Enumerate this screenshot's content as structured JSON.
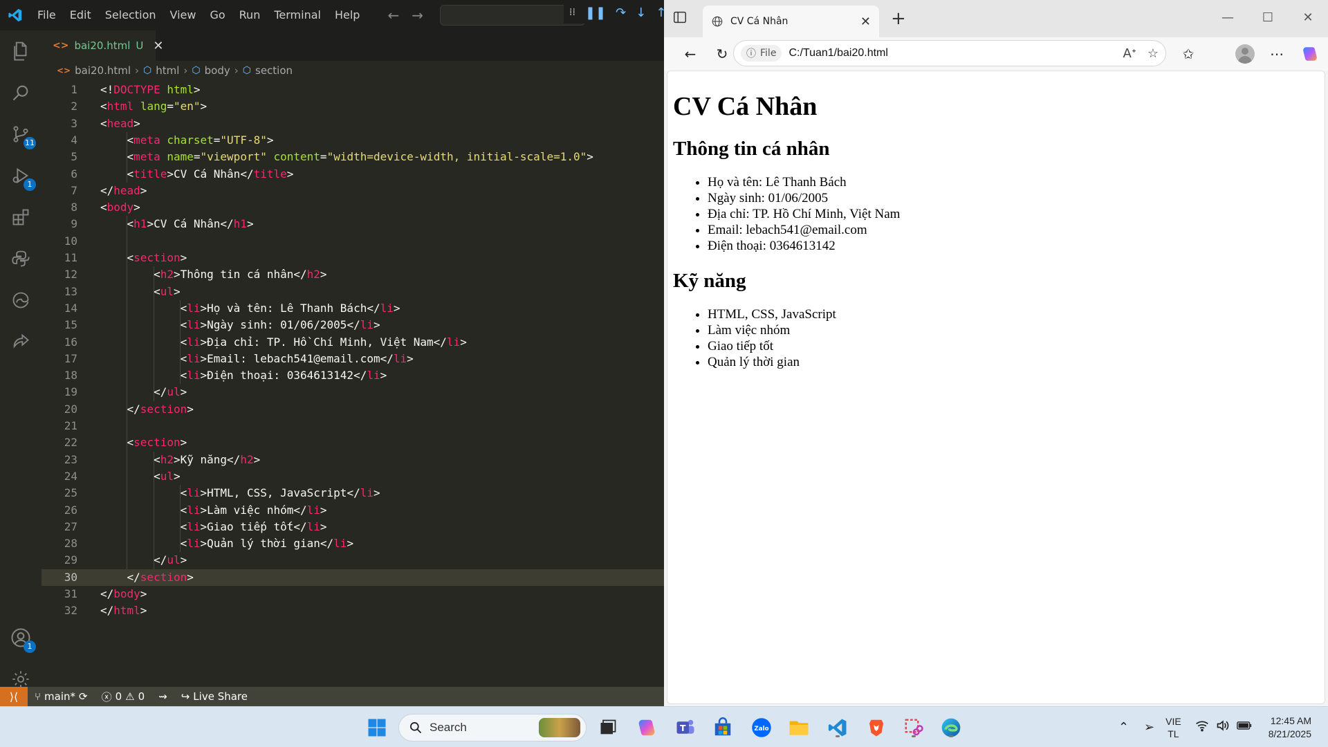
{
  "vscode": {
    "menu": [
      "File",
      "Edit",
      "Selection",
      "View",
      "Go",
      "Run",
      "Terminal",
      "Help"
    ],
    "activity_badges": {
      "source_control": "11",
      "run_debug": "1",
      "accounts": "1"
    },
    "tab": {
      "label": "bai20.html",
      "status": "U",
      "icon": "<>"
    },
    "breadcrumb": [
      "bai20.html",
      "html",
      "body",
      "section"
    ],
    "current_line": 30,
    "code_lines": [
      "<!DOCTYPE html>",
      "<html lang=\"en\">",
      "<head>",
      "    <meta charset=\"UTF-8\">",
      "    <meta name=\"viewport\" content=\"width=device-width, initial-scale=1.0\">",
      "    <title>CV Cá Nhân</title>",
      "</head>",
      "<body>",
      "    <h1>CV Cá Nhân</h1>",
      "",
      "    <section>",
      "        <h2>Thông tin cá nhân</h2>",
      "        <ul>",
      "            <li>Họ và tên: Lê Thanh Bách</li>",
      "            <li>Ngày sinh: 01/06/2005</li>",
      "            <li>Địa chỉ: TP. Hồ Chí Minh, Việt Nam</li>",
      "            <li>Email: lebach541@email.com</li>",
      "            <li>Điện thoại: 0364613142</li>",
      "        </ul>",
      "    </section>",
      "",
      "    <section>",
      "        <h2>Kỹ năng</h2>",
      "        <ul>",
      "            <li>HTML, CSS, JavaScript</li>",
      "            <li>Làm việc nhóm</li>",
      "            <li>Giao tiếp tốt</li>",
      "            <li>Quản lý thời gian</li>",
      "        </ul>",
      "    </section>",
      "</body>",
      "</html>"
    ],
    "statusbar": {
      "branch": "main*",
      "errors": "0",
      "warnings": "0",
      "live_share": "Live Share"
    }
  },
  "browser": {
    "tab_title": "CV Cá Nhân",
    "site_info": "File",
    "url": "C:/Tuan1/bai20.html",
    "page": {
      "h1": "CV Cá Nhân",
      "sections": [
        {
          "heading": "Thông tin cá nhân",
          "items": [
            "Họ và tên: Lê Thanh Bách",
            "Ngày sinh: 01/06/2005",
            "Địa chỉ: TP. Hồ Chí Minh, Việt Nam",
            "Email: lebach541@email.com",
            "Điện thoại: 0364613142"
          ]
        },
        {
          "heading": "Kỹ năng",
          "items": [
            "HTML, CSS, JavaScript",
            "Làm việc nhóm",
            "Giao tiếp tốt",
            "Quản lý thời gian"
          ]
        }
      ]
    }
  },
  "taskbar": {
    "search_label": "Search",
    "apps": [
      "start-icon",
      "search-icon",
      "task-view-icon",
      "copilot-icon",
      "teams-icon",
      "store-icon",
      "zalo-icon",
      "file-explorer-icon",
      "vscode-icon",
      "brave-icon",
      "snipping-tool-icon",
      "edge-icon"
    ],
    "zalo_label": "Zalo",
    "lang_line1": "VIE",
    "lang_line2": "TL",
    "time": "12:45 AM",
    "date": "8/21/2025"
  },
  "colors": {
    "vscode_bg": "#272822",
    "tag": "#f92672",
    "attr": "#a6e22e",
    "string": "#e6db74",
    "statusbar": "#414339",
    "remote": "#d4701f",
    "taskbar": "#d9e6f2"
  }
}
